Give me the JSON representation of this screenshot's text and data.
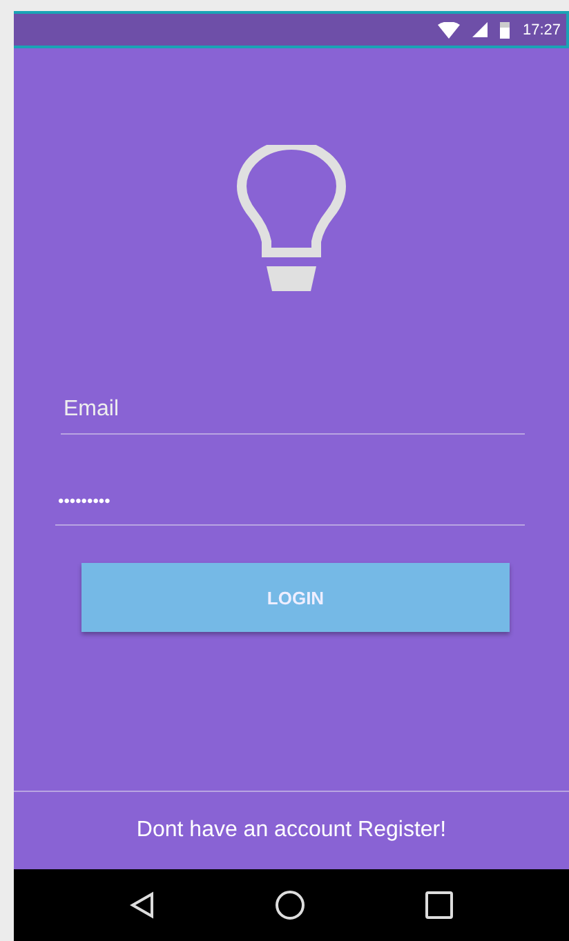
{
  "status_bar": {
    "time": "17:27"
  },
  "email_field": {
    "placeholder": "Email"
  },
  "password_field": {
    "value": "•••••••••"
  },
  "login_button": {
    "label": "LOGIN"
  },
  "register_link": {
    "label": "Dont have an account Register!"
  }
}
